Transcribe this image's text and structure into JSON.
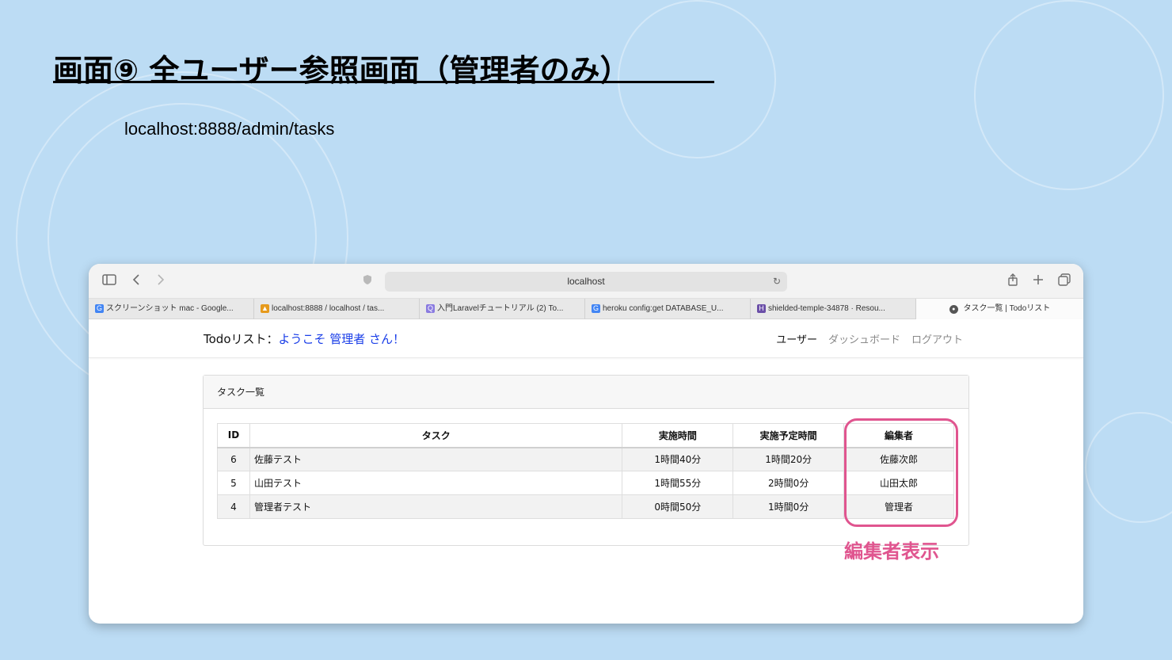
{
  "slide": {
    "title": "画面⑨ 全ユーザー参照画面（管理者のみ）",
    "url_text": "localhost:8888/admin/tasks",
    "highlight_label": "編集者表示"
  },
  "browser": {
    "address": "localhost",
    "icons": {
      "sidebar": "sidebar-icon",
      "back": "chevron-left-icon",
      "forward": "chevron-right-icon",
      "shield": "shield-icon",
      "reload": "reload-icon",
      "share": "share-icon",
      "new_tab": "plus-icon",
      "tabs_overview": "tabs-icon"
    },
    "tabs": [
      {
        "label": "スクリーンショット mac - Google...",
        "favicon": "G",
        "color": "#4285f4"
      },
      {
        "label": "localhost:8888 / localhost / tas...",
        "favicon": "▲",
        "color": "#e69a1c"
      },
      {
        "label": "入門Laravelチュートリアル (2) To...",
        "favicon": "Q",
        "color": "#8a7be0"
      },
      {
        "label": "heroku config:get DATABASE_U...",
        "favicon": "G",
        "color": "#4285f4"
      },
      {
        "label": "shielded-temple-34878 · Resou...",
        "favicon": "H",
        "color": "#6b4fa8"
      },
      {
        "label": "タスク一覧 | Todoリスト",
        "favicon": "●",
        "color": "#555555"
      }
    ]
  },
  "app": {
    "brand": "Todoリスト：",
    "welcome": "ようこそ 管理者 さん！",
    "nav": [
      "ユーザー",
      "ダッシュボード",
      "ログアウト"
    ],
    "card_title": "タスク一覧",
    "columns": [
      "ID",
      "タスク",
      "実施時間",
      "実施予定時間",
      "編集者"
    ],
    "rows": [
      [
        "6",
        "佐藤テスト",
        "1時間40分",
        "1時間20分",
        "佐藤次郎"
      ],
      [
        "5",
        "山田テスト",
        "1時間55分",
        "2時間0分",
        "山田太郎"
      ],
      [
        "4",
        "管理者テスト",
        "0時間50分",
        "1時間0分",
        "管理者"
      ]
    ]
  },
  "colors": {
    "background": "#bcdcf4",
    "highlight": "#e0558f",
    "welcome_link": "#1a3ee8"
  }
}
